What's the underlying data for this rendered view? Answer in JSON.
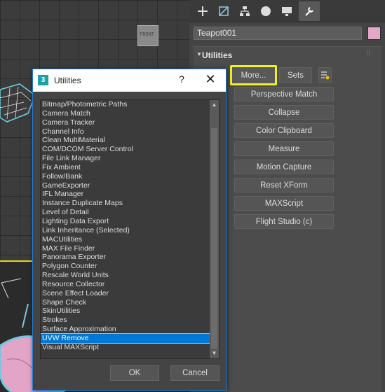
{
  "object": {
    "name": "Teapot001",
    "color": "#e4a8c6"
  },
  "panel_tabs": [
    {
      "icon": "create-plus-icon"
    },
    {
      "icon": "modify-icon"
    },
    {
      "icon": "hierarchy-icon"
    },
    {
      "icon": "motion-icon"
    },
    {
      "icon": "display-icon"
    },
    {
      "icon": "utilities-wrench-icon",
      "active": true
    }
  ],
  "utilities": {
    "title": "Utilities",
    "more_label": "More...",
    "sets_label": "Sets",
    "buttons": [
      "Perspective Match",
      "Collapse",
      "Color Clipboard",
      "Measure",
      "Motion Capture",
      "Reset XForm",
      "MAXScript",
      "Flight Studio (c)"
    ]
  },
  "viewport": {
    "label": "FRONT"
  },
  "dialog": {
    "title": "Utilities",
    "help": "?",
    "close": "✕",
    "items": [
      "Bitmap/Photometric Paths",
      "Camera Match",
      "Camera Tracker",
      "Channel Info",
      "Clean MultiMaterial",
      "COM/DCOM Server Control",
      "File Link Manager",
      "Fix Ambient",
      "Follow/Bank",
      "GameExporter",
      "IFL Manager",
      "Instance Duplicate Maps",
      "Level of Detail",
      "Lighting Data Export",
      "Link Inheritance (Selected)",
      "MACUtilities",
      "MAX File Finder",
      "Panorama Exporter",
      "Polygon Counter",
      "Rescale World Units",
      "Resource Collector",
      "Scene Effect Loader",
      "Shape Check",
      "SkinUtilities",
      "Strokes",
      "Surface Approximation",
      "UVW Remove",
      "Visual MAXScript"
    ],
    "selected": "UVW Remove",
    "ok_label": "OK",
    "cancel_label": "Cancel"
  }
}
